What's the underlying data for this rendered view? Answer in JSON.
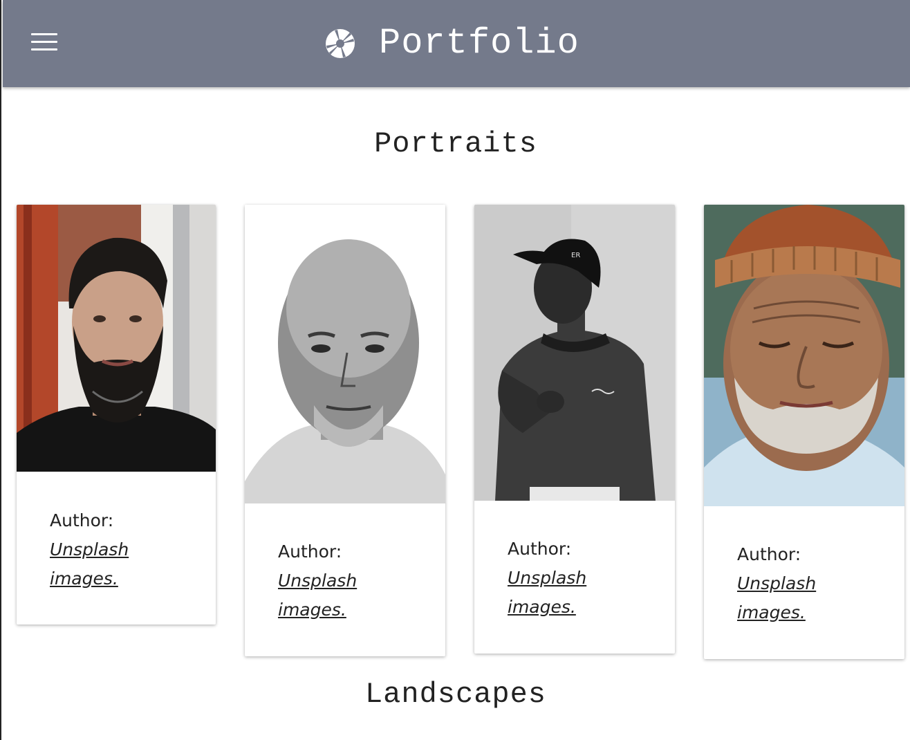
{
  "header": {
    "menu_icon": "hamburger-menu-icon",
    "brand_icon": "camera-aperture-icon",
    "title": "Portfolio",
    "background": "#747a8b"
  },
  "sections": {
    "portraits": {
      "title": "Portraits"
    },
    "landscapes": {
      "title": "Landscapes"
    }
  },
  "cards": [
    {
      "author_label": "Author:",
      "link_line1": "Unsplash",
      "link_line2": "images.",
      "photo": "bearded-man-portrait"
    },
    {
      "author_label": "Author:",
      "link_line1": "Unsplash",
      "link_line2": "images.",
      "photo": "older-man-black-and-white-portrait"
    },
    {
      "author_label": "Author:",
      "link_line1": "Unsplash",
      "link_line2": "images.",
      "photo": "young-man-cap-black-and-white-portrait"
    },
    {
      "author_label": "Author:",
      "link_line1": "Unsplash",
      "link_line2": "images.",
      "photo": "elderly-man-knit-hat-portrait"
    }
  ]
}
